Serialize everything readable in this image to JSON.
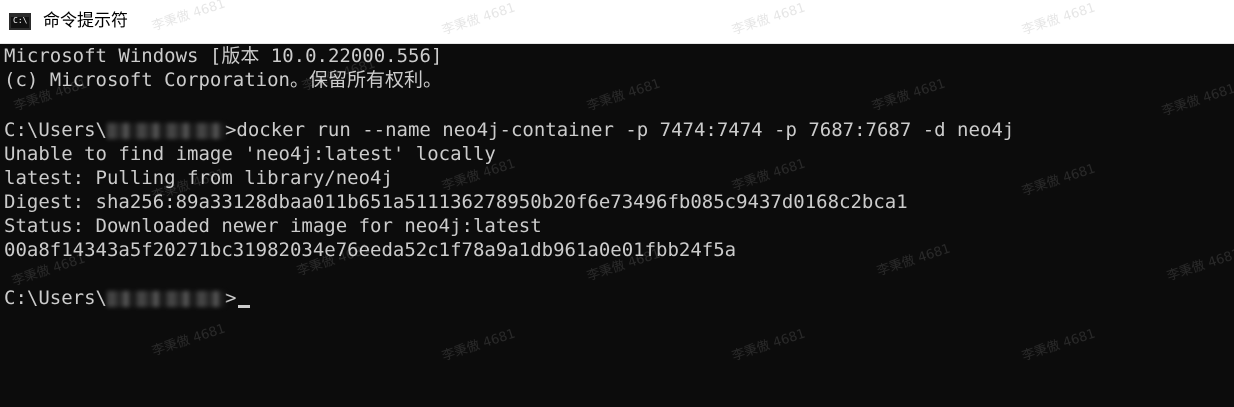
{
  "window": {
    "title": "命令提示符",
    "icon": "cmd-icon",
    "icon_glyph": "C:\\"
  },
  "console": {
    "lines": [
      "Microsoft Windows [版本 10.0.22000.556]",
      "(c) Microsoft Corporation。保留所有权利。",
      "",
      "docker run --name neo4j-container -p 7474:7474 -p 7687:7687 -d neo4j",
      "Unable to find image 'neo4j:latest' locally",
      "latest: Pulling from library/neo4j",
      "Digest: sha256:89a33128dbaa011b651a511136278950b20f6e73496fb085c9437d0168c2bca1",
      "Status: Downloaded newer image for neo4j:latest",
      "00a8f14343a5f20271bc31982034e76eeda52c1f78a9a1db961a0e01fbb24f5a",
      ""
    ],
    "prompt_prefix": "C:\\Users\\",
    "prompt_suffix": ">",
    "prompt_prefix_2": "C:\\Users\\",
    "colors": {
      "background": "#0c0c0c",
      "foreground": "#cccccc"
    }
  },
  "watermark": "李秉傲 4681"
}
